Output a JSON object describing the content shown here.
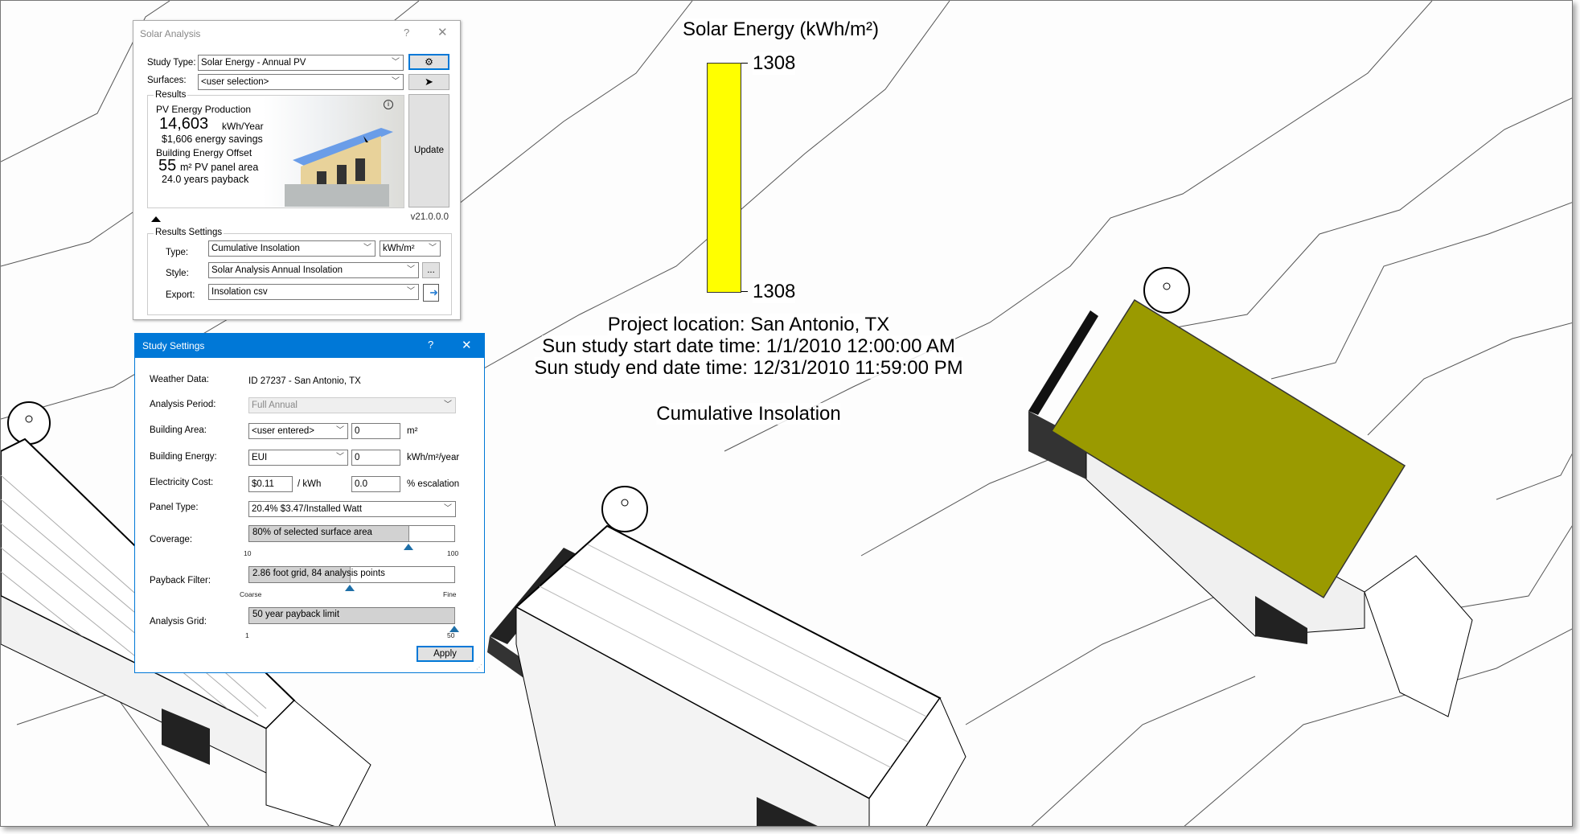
{
  "legend": {
    "title": "Solar Energy (kWh/m²)",
    "max_label": "1308",
    "min_label": "1308",
    "bar_color": "#ffff00",
    "location": "Project location: San Antonio, TX",
    "start": "Sun study start date time: 1/1/2010 12:00:00 AM",
    "end": "Sun study end date time: 12/31/2010 11:59:00 PM",
    "type": "Cumulative Insolation"
  },
  "scene": {
    "roof_color": "#9a9a00"
  },
  "solar_analysis": {
    "title": "Solar Analysis",
    "help": "?",
    "close": "✕",
    "study_type_label": "Study Type:",
    "study_type_value": "Solar Energy - Annual PV",
    "surfaces_label": "Surfaces:",
    "surfaces_value": "<user selection>",
    "results_label": "Results",
    "pv_heading": "PV Energy Production",
    "pv_value": "14,603",
    "pv_unit": "kWh/Year",
    "savings": "$1,606 energy savings",
    "offset_heading": "Building Energy Offset",
    "area_value": "55",
    "area_unit": "m² PV panel area",
    "payback": "24.0 years payback",
    "update": "Update",
    "version": "v21.0.0.0",
    "results_settings_label": "Results Settings",
    "type_label": "Type:",
    "type_value": "Cumulative Insolation",
    "unit_value": "kWh/m²",
    "style_label": "Style:",
    "style_value": "Solar Analysis Annual Insolation",
    "style_more": "...",
    "export_label": "Export:",
    "export_value": "Insolation csv"
  },
  "study_settings": {
    "title": "Study Settings",
    "help": "?",
    "close": "✕",
    "title_color": "#0078d7",
    "weather_label": "Weather Data:",
    "weather_value": "ID 27237 - San Antonio, TX",
    "period_label": "Analysis Period:",
    "period_value": "Full Annual",
    "area_label": "Building Area:",
    "area_mode": "<user entered>",
    "area_value": "0",
    "area_unit": "m²",
    "energy_label": "Building Energy:",
    "energy_mode": "EUI",
    "energy_value": "0",
    "energy_unit": "kWh/m²/year",
    "cost_label": "Electricity Cost:",
    "cost_value": "$0.11",
    "cost_unit": "/ kWh",
    "escalation_value": "0.0",
    "escalation_unit": "% escalation",
    "panel_label": "Panel Type:",
    "panel_value": "20.4% $3.47/Installed Watt",
    "coverage_label": "Coverage:",
    "coverage_text": "80% of selected surface area",
    "coverage_value": 80,
    "coverage_min": "10",
    "coverage_max": "100",
    "payback_label": "Payback Filter:",
    "payback_text": "2.86 foot grid, 84 analysis points",
    "payback_fraction": 0.49,
    "payback_min": "Coarse",
    "payback_max": "Fine",
    "grid_label": "Analysis Grid:",
    "grid_text": "50 year payback limit",
    "grid_value": 50,
    "grid_min": "1",
    "grid_max": "50",
    "apply": "Apply"
  }
}
